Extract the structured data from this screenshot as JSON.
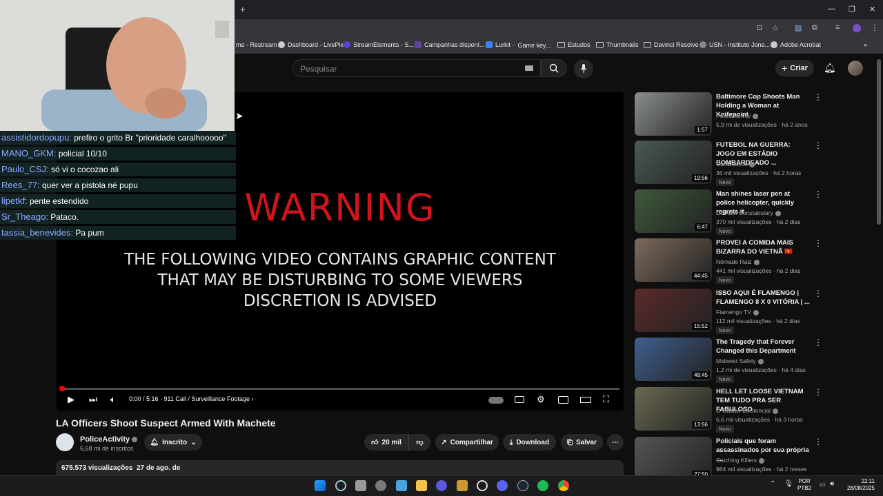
{
  "bookmarks": [
    "me - Restream",
    "Dashboard - LivePix",
    "StreamElements - S...",
    "Campanhas disponí...",
    "Lurkit",
    "Game key...",
    "Estudos",
    "Thumbnails",
    "Davinci Resolve",
    "USN - Instituto Jone...",
    "Adobe Acrobat"
  ],
  "header": {
    "search_placeholder": "Pesquisar",
    "create_label": "Criar"
  },
  "chat": [
    {
      "user": "assistidordopupu:",
      "msg": "prefiro o grito Br \"prioridade caralhooooo\""
    },
    {
      "user": "MANO_GKM:",
      "msg": "policial 10/10"
    },
    {
      "user": "Paulo_CSJ:",
      "msg": "só vi o cocozao ali"
    },
    {
      "user": "Rees_77:",
      "msg": "quer ver a pistola né pupu"
    },
    {
      "user": "lipetkf:",
      "msg": "pente estendido"
    },
    {
      "user": "Sr_Theago:",
      "msg": "Pataco."
    },
    {
      "user": "tassia_benevides:",
      "msg": "Pa pum"
    }
  ],
  "video": {
    "warning": "WARNING",
    "warn_lines": [
      "THE FOLLOWING VIDEO CONTAINS GRAPHIC CONTENT",
      "THAT MAY BE DISTURBING TO SOME VIEWERS",
      "DISCRETION IS ADVISED"
    ],
    "time": "0:00 / 5:16",
    "chapter": "911 Call / Surveillance Footage",
    "progress": 0.0,
    "title": "LA Officers Shoot Suspect Armed With Machete"
  },
  "channel": {
    "name": "PoliceActivity",
    "subs": "6,68 mi de inscritos",
    "subscribed_label": "Inscrito"
  },
  "actions": {
    "likes": "20 mil",
    "share": "Compartilhar",
    "download": "Download",
    "save": "Salvar"
  },
  "description": {
    "stats": "675.573 visualizações",
    "date": "27 de ago. de"
  },
  "recommendations": [
    {
      "title": "Baltimore Cop Shoots Man Holding a Woman at Knifepoint",
      "channel": "PoliceActivity",
      "meta": "5,9 mi de visualizações · há 2 anos",
      "duration": "1:57",
      "badge": "",
      "color": "#8a8f8c"
    },
    {
      "title": "FUTEBOL NA GUERRA: JOGO EM ESTÁDIO BOMBARDEADO ...",
      "channel": "Cartoloucos",
      "meta": "36 mil visualizações · há 2 horas",
      "duration": "19:56",
      "badge": "Novo",
      "color": "#4a5a52"
    },
    {
      "title": "Man shines laser pen at police helicopter, quickly regrets it",
      "channel": "Durham Constabulary",
      "meta": "370 mil visualizações · há 2 dias",
      "duration": "6:47",
      "badge": "Novo",
      "color": "#3e5a3a"
    },
    {
      "title": "PROVEI A COMIDA MAIS BIZARRA DO VIETNÃ 🇻🇳",
      "channel": "Nômade Raiz",
      "meta": "441 mil visualizações · há 2 dias",
      "duration": "44:45",
      "badge": "Novo",
      "color": "#7d6a5c"
    },
    {
      "title": "ISSO AQUI É FLAMENGO | FLAMENGO 8 X 0 VITÓRIA | ...",
      "channel": "Flamengo TV",
      "meta": "112 mil visualizações · há 2 dias",
      "duration": "15:52",
      "badge": "Novo",
      "color": "#5a2a2a"
    },
    {
      "title": "The Tragedy that Forever Changed this Department",
      "channel": "Midwest Safety",
      "meta": "1,2 mi de visualizações · há 4 dias",
      "duration": "48:45",
      "badge": "Novo",
      "color": "#3f5f8f"
    },
    {
      "title": "HELL LET LOOSE VIETNAM TEM TUDO PRA SER FABULOSO",
      "channel": "O Gustav Existencial",
      "meta": "6,6 mil visualizações · há 3 horas",
      "duration": "13:56",
      "badge": "Novo",
      "color": "#6b6a52"
    },
    {
      "title": "Policiais que foram assassinados por sua própria ...",
      "channel": "Catching Killers",
      "meta": "984 mil visualizações · há 2 meses",
      "duration": "27:50",
      "badge": "",
      "color": "#555555"
    }
  ],
  "tray": {
    "lang": "POR",
    "layout": "PTB2",
    "time": "22:11",
    "date": "28/08/2025"
  },
  "colors": {
    "accent": "#ff0000",
    "warning": "#d1141c",
    "chat_user": "#8fa8ff"
  }
}
